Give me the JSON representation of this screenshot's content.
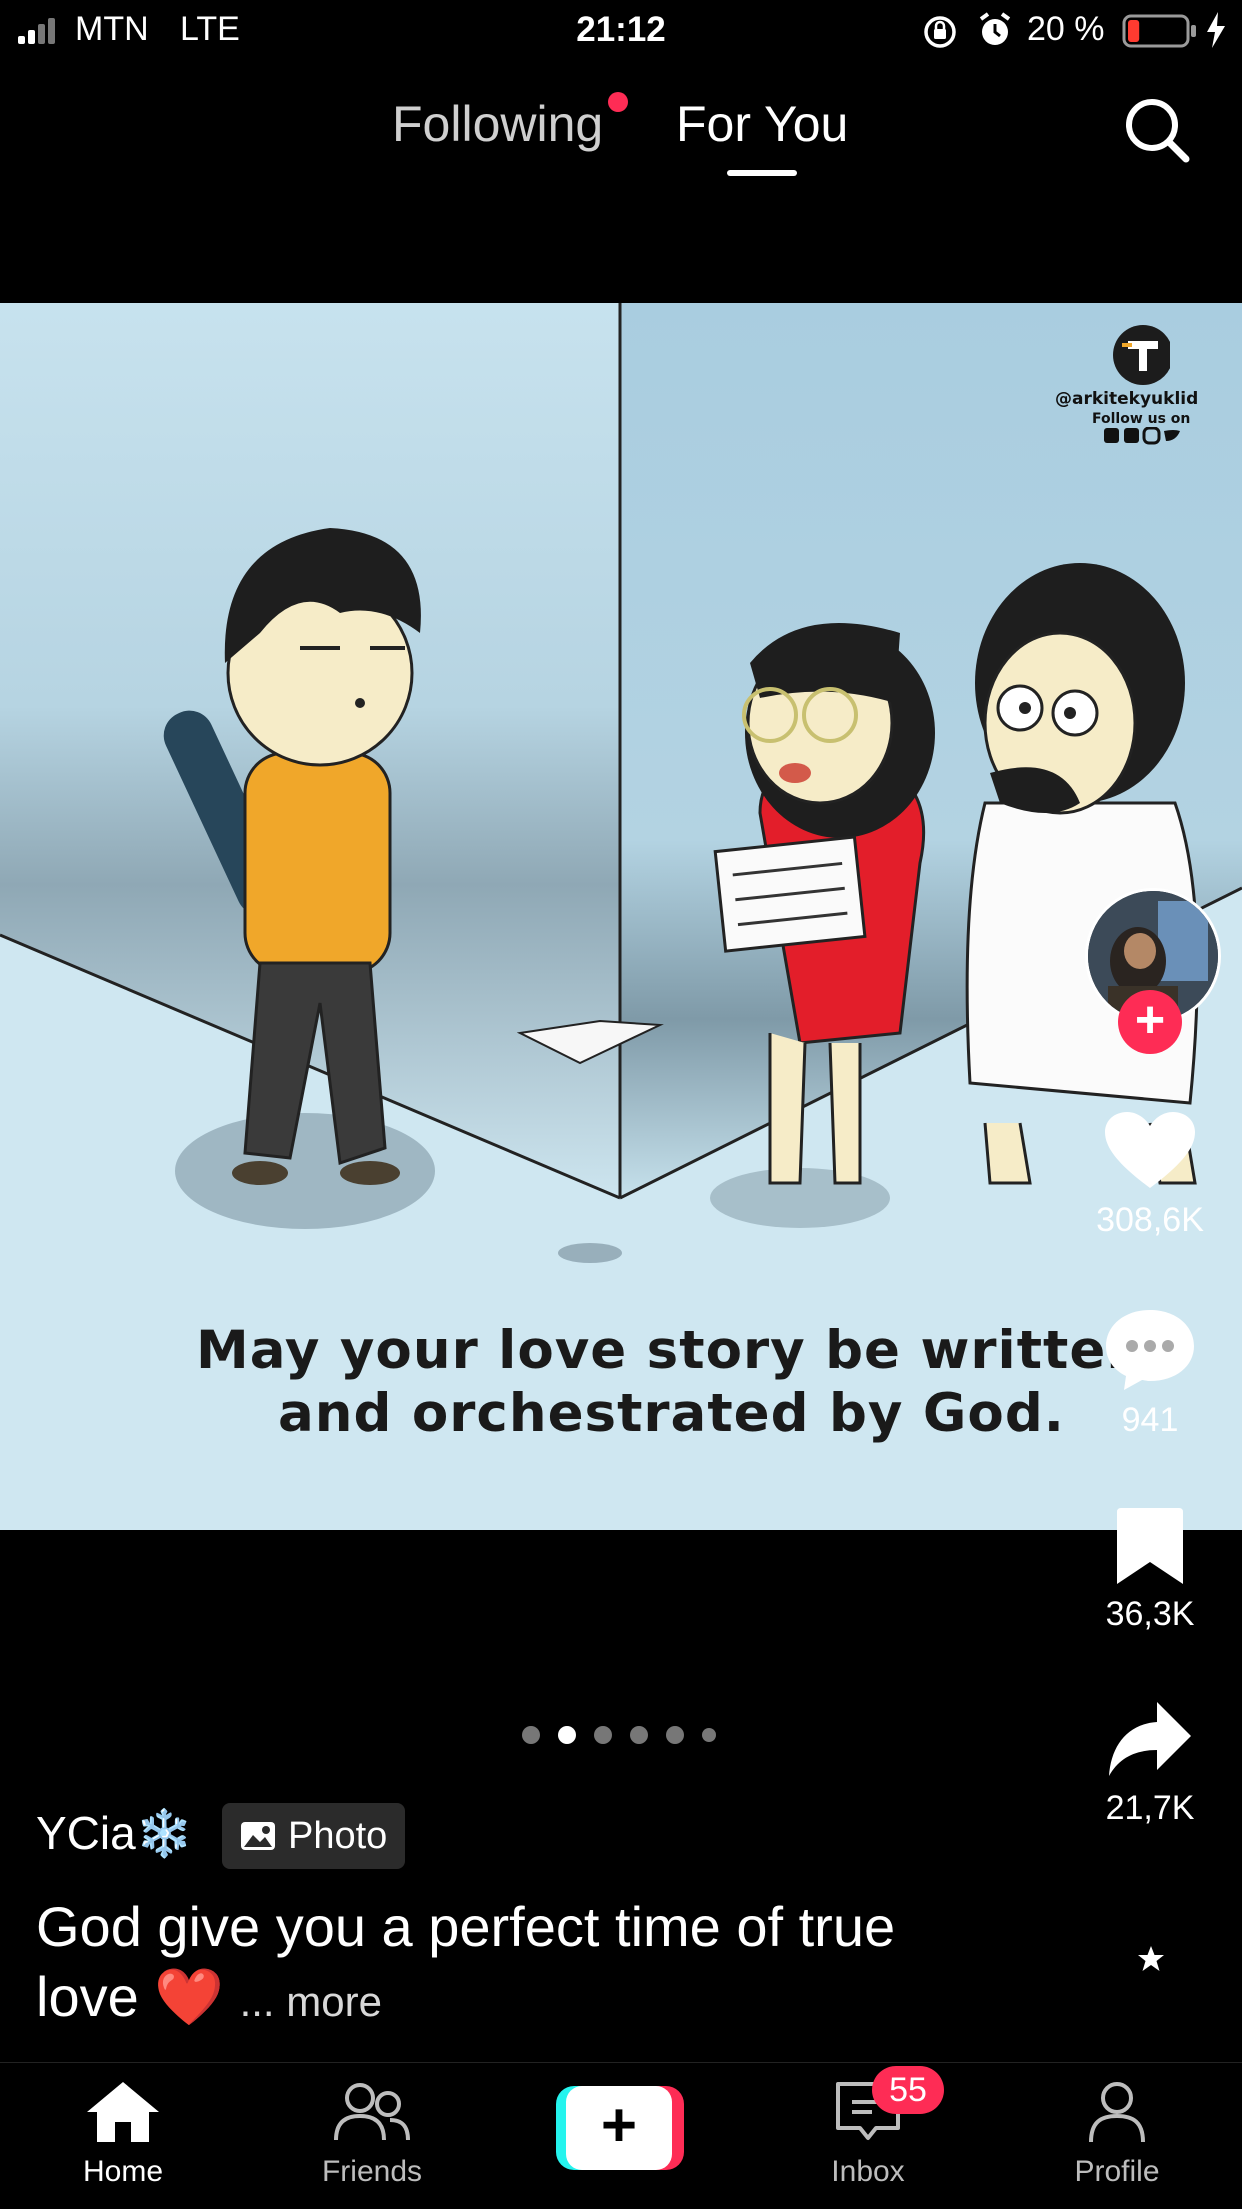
{
  "status_bar": {
    "carrier": "MTN",
    "network": "LTE",
    "time": "21:12",
    "battery_percent": "20 %",
    "battery_level": 0.2,
    "battery_color": "#ff3b30"
  },
  "top_nav": {
    "tabs": [
      {
        "label": "Following",
        "has_notification_dot": true
      },
      {
        "label": "For You",
        "selected": true
      }
    ],
    "search_icon": "search-icon"
  },
  "post": {
    "image_caption_line1": "May your love story be written",
    "image_caption_line2": "and orchestrated by God.",
    "watermark_handle": "@arkitekyuklid",
    "watermark_follow": "Follow us on",
    "author": "YCia",
    "author_emoji": "❄️",
    "badge_label": "Photo",
    "caption_text": "God give you a perfect time of true love",
    "caption_emoji": "❤️",
    "caption_more": "... more",
    "page_count": 6,
    "current_page": 2
  },
  "actions": {
    "likes": "308,6K",
    "comments": "941",
    "saves": "36,3K",
    "shares": "21,7K"
  },
  "bottom_nav": {
    "items": [
      {
        "label": "Home",
        "icon": "home-icon",
        "selected": true
      },
      {
        "label": "Friends",
        "icon": "friends-icon"
      },
      {
        "label": "",
        "icon": "plus-icon"
      },
      {
        "label": "Inbox",
        "icon": "inbox-icon",
        "badge": "55"
      },
      {
        "label": "Profile",
        "icon": "profile-icon"
      }
    ]
  },
  "colors": {
    "accent": "#fe2c55",
    "create_cyan": "#25f4ee",
    "background": "#000000"
  }
}
